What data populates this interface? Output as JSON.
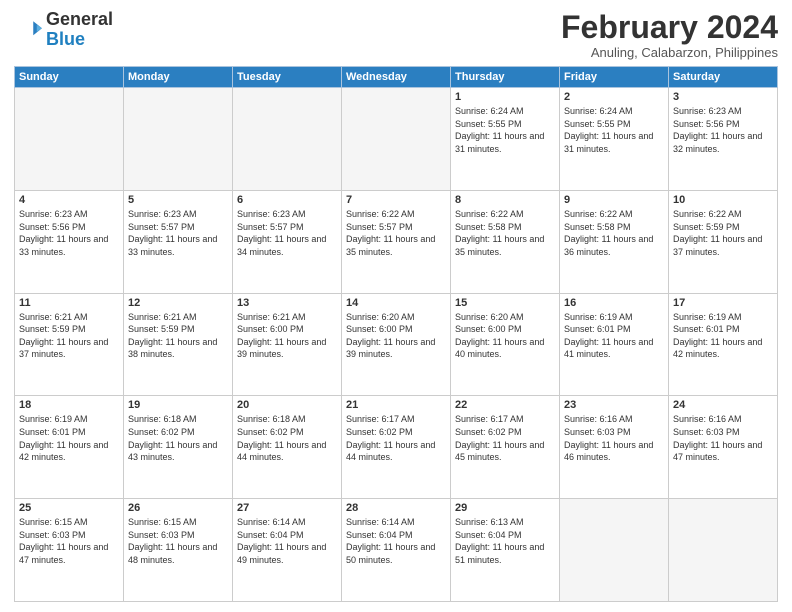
{
  "header": {
    "logo_general": "General",
    "logo_blue": "Blue",
    "month_title": "February 2024",
    "location": "Anuling, Calabarzon, Philippines"
  },
  "days_of_week": [
    "Sunday",
    "Monday",
    "Tuesday",
    "Wednesday",
    "Thursday",
    "Friday",
    "Saturday"
  ],
  "weeks": [
    [
      {
        "day": "",
        "info": ""
      },
      {
        "day": "",
        "info": ""
      },
      {
        "day": "",
        "info": ""
      },
      {
        "day": "",
        "info": ""
      },
      {
        "day": "1",
        "info": "Sunrise: 6:24 AM\nSunset: 5:55 PM\nDaylight: 11 hours and 31 minutes."
      },
      {
        "day": "2",
        "info": "Sunrise: 6:24 AM\nSunset: 5:55 PM\nDaylight: 11 hours and 31 minutes."
      },
      {
        "day": "3",
        "info": "Sunrise: 6:23 AM\nSunset: 5:56 PM\nDaylight: 11 hours and 32 minutes."
      }
    ],
    [
      {
        "day": "4",
        "info": "Sunrise: 6:23 AM\nSunset: 5:56 PM\nDaylight: 11 hours and 33 minutes."
      },
      {
        "day": "5",
        "info": "Sunrise: 6:23 AM\nSunset: 5:57 PM\nDaylight: 11 hours and 33 minutes."
      },
      {
        "day": "6",
        "info": "Sunrise: 6:23 AM\nSunset: 5:57 PM\nDaylight: 11 hours and 34 minutes."
      },
      {
        "day": "7",
        "info": "Sunrise: 6:22 AM\nSunset: 5:57 PM\nDaylight: 11 hours and 35 minutes."
      },
      {
        "day": "8",
        "info": "Sunrise: 6:22 AM\nSunset: 5:58 PM\nDaylight: 11 hours and 35 minutes."
      },
      {
        "day": "9",
        "info": "Sunrise: 6:22 AM\nSunset: 5:58 PM\nDaylight: 11 hours and 36 minutes."
      },
      {
        "day": "10",
        "info": "Sunrise: 6:22 AM\nSunset: 5:59 PM\nDaylight: 11 hours and 37 minutes."
      }
    ],
    [
      {
        "day": "11",
        "info": "Sunrise: 6:21 AM\nSunset: 5:59 PM\nDaylight: 11 hours and 37 minutes."
      },
      {
        "day": "12",
        "info": "Sunrise: 6:21 AM\nSunset: 5:59 PM\nDaylight: 11 hours and 38 minutes."
      },
      {
        "day": "13",
        "info": "Sunrise: 6:21 AM\nSunset: 6:00 PM\nDaylight: 11 hours and 39 minutes."
      },
      {
        "day": "14",
        "info": "Sunrise: 6:20 AM\nSunset: 6:00 PM\nDaylight: 11 hours and 39 minutes."
      },
      {
        "day": "15",
        "info": "Sunrise: 6:20 AM\nSunset: 6:00 PM\nDaylight: 11 hours and 40 minutes."
      },
      {
        "day": "16",
        "info": "Sunrise: 6:19 AM\nSunset: 6:01 PM\nDaylight: 11 hours and 41 minutes."
      },
      {
        "day": "17",
        "info": "Sunrise: 6:19 AM\nSunset: 6:01 PM\nDaylight: 11 hours and 42 minutes."
      }
    ],
    [
      {
        "day": "18",
        "info": "Sunrise: 6:19 AM\nSunset: 6:01 PM\nDaylight: 11 hours and 42 minutes."
      },
      {
        "day": "19",
        "info": "Sunrise: 6:18 AM\nSunset: 6:02 PM\nDaylight: 11 hours and 43 minutes."
      },
      {
        "day": "20",
        "info": "Sunrise: 6:18 AM\nSunset: 6:02 PM\nDaylight: 11 hours and 44 minutes."
      },
      {
        "day": "21",
        "info": "Sunrise: 6:17 AM\nSunset: 6:02 PM\nDaylight: 11 hours and 44 minutes."
      },
      {
        "day": "22",
        "info": "Sunrise: 6:17 AM\nSunset: 6:02 PM\nDaylight: 11 hours and 45 minutes."
      },
      {
        "day": "23",
        "info": "Sunrise: 6:16 AM\nSunset: 6:03 PM\nDaylight: 11 hours and 46 minutes."
      },
      {
        "day": "24",
        "info": "Sunrise: 6:16 AM\nSunset: 6:03 PM\nDaylight: 11 hours and 47 minutes."
      }
    ],
    [
      {
        "day": "25",
        "info": "Sunrise: 6:15 AM\nSunset: 6:03 PM\nDaylight: 11 hours and 47 minutes."
      },
      {
        "day": "26",
        "info": "Sunrise: 6:15 AM\nSunset: 6:03 PM\nDaylight: 11 hours and 48 minutes."
      },
      {
        "day": "27",
        "info": "Sunrise: 6:14 AM\nSunset: 6:04 PM\nDaylight: 11 hours and 49 minutes."
      },
      {
        "day": "28",
        "info": "Sunrise: 6:14 AM\nSunset: 6:04 PM\nDaylight: 11 hours and 50 minutes."
      },
      {
        "day": "29",
        "info": "Sunrise: 6:13 AM\nSunset: 6:04 PM\nDaylight: 11 hours and 51 minutes."
      },
      {
        "day": "",
        "info": ""
      },
      {
        "day": "",
        "info": ""
      }
    ]
  ]
}
